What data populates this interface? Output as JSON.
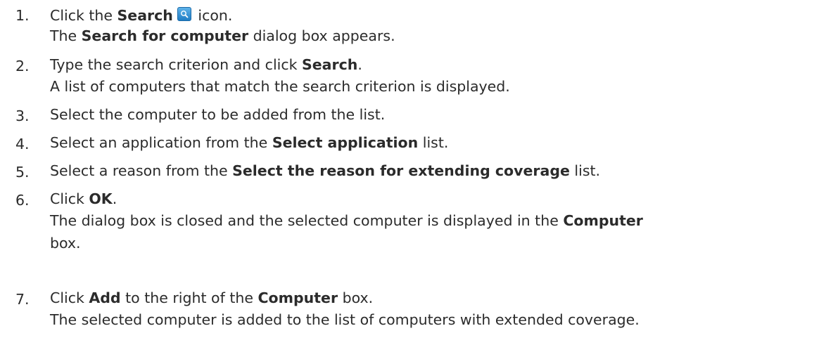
{
  "steps": [
    {
      "number": "1.",
      "line1": {
        "a": "Click the ",
        "b": "Search",
        "c": " icon."
      },
      "line2": {
        "a": "The ",
        "b": "Search for computer",
        "c": " dialog box appears."
      },
      "icon": "search-icon"
    },
    {
      "number": "2.",
      "line1": {
        "a": "Type the search criterion and click ",
        "b": "Search",
        "c": "."
      },
      "line2": {
        "a": "A list of computers that match the search criterion is displayed."
      }
    },
    {
      "number": "3.",
      "line1": {
        "a": "Select the computer to be added from the list."
      }
    },
    {
      "number": "4.",
      "line1": {
        "a": "Select an application from the ",
        "b": "Select application",
        "c": " list."
      }
    },
    {
      "number": "5.",
      "line1": {
        "a": "Select a reason from the ",
        "b": "Select the reason for extending coverage",
        "c": " list."
      }
    },
    {
      "number": "6.",
      "line1": {
        "a": "Click ",
        "b": "OK",
        "c": "."
      },
      "line2": {
        "a": "The dialog box is closed and the selected computer is displayed in the ",
        "b": "Computer"
      },
      "line3": {
        "a": "box."
      }
    },
    {
      "number": "7.",
      "line1": {
        "a": "Click ",
        "b": "Add",
        "c": " to the right of the ",
        "d": "Computer",
        "e": " box."
      },
      "line2": {
        "a": "The selected computer is added to the list of computers with extended coverage."
      }
    }
  ],
  "colors": {
    "text": "#2b2b2b",
    "icon_top": "#5fb3ea",
    "icon_bottom": "#1f7cc4"
  }
}
